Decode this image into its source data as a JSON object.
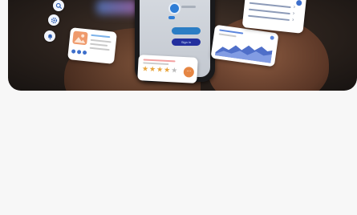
{
  "hero": {
    "phone": {
      "button_primary": "",
      "button_secondary": "Sign in"
    },
    "side_icons": [
      "search-icon",
      "settings-icon",
      "bell-icon"
    ],
    "rating_card": {
      "stars_filled": 4,
      "stars_total": 5
    },
    "colors": {
      "accent_blue": "#2f7dd6",
      "accent_orange": "#e58644",
      "star_gold": "#e7a43a",
      "chart_blue": "#4f6fc9"
    }
  },
  "content": {}
}
